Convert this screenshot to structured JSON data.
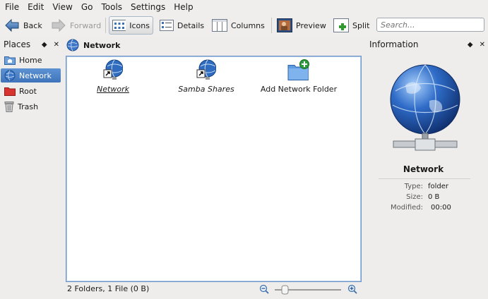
{
  "menu": [
    "File",
    "Edit",
    "View",
    "Go",
    "Tools",
    "Settings",
    "Help"
  ],
  "menu_mnemonics": [
    "F",
    "E",
    "V",
    "G",
    "T",
    "S",
    "H"
  ],
  "toolbar": {
    "back": "Back",
    "forward": "Forward",
    "icons": "Icons",
    "details": "Details",
    "columns": "Columns",
    "preview": "Preview",
    "split": "Split",
    "search_placeholder": "Search..."
  },
  "places": {
    "title": "Places",
    "items": [
      {
        "label": "Home",
        "icon": "home-folder-icon",
        "selected": false
      },
      {
        "label": "Network",
        "icon": "network-globe-icon",
        "selected": true
      },
      {
        "label": "Root",
        "icon": "root-folder-icon",
        "selected": false
      },
      {
        "label": "Trash",
        "icon": "trash-icon",
        "selected": false
      }
    ]
  },
  "location": {
    "title": "Network"
  },
  "files": [
    {
      "label": "Network",
      "icon": "network-globe-link-icon"
    },
    {
      "label": "Samba Shares",
      "icon": "network-globe-link-icon"
    },
    {
      "label": "Add Network Folder",
      "icon": "folder-add-icon"
    }
  ],
  "status": {
    "text": "2 Folders, 1 File (0 B)"
  },
  "info": {
    "title": "Information",
    "name": "Network",
    "type_label": "Type:",
    "type_value": "folder",
    "size_label": "Size:",
    "size_value": "0 B",
    "modified_label": "Modified:",
    "modified_value": "00:00"
  },
  "colors": {
    "selection": "#4a7fc4",
    "view_border": "#6e95c7"
  }
}
